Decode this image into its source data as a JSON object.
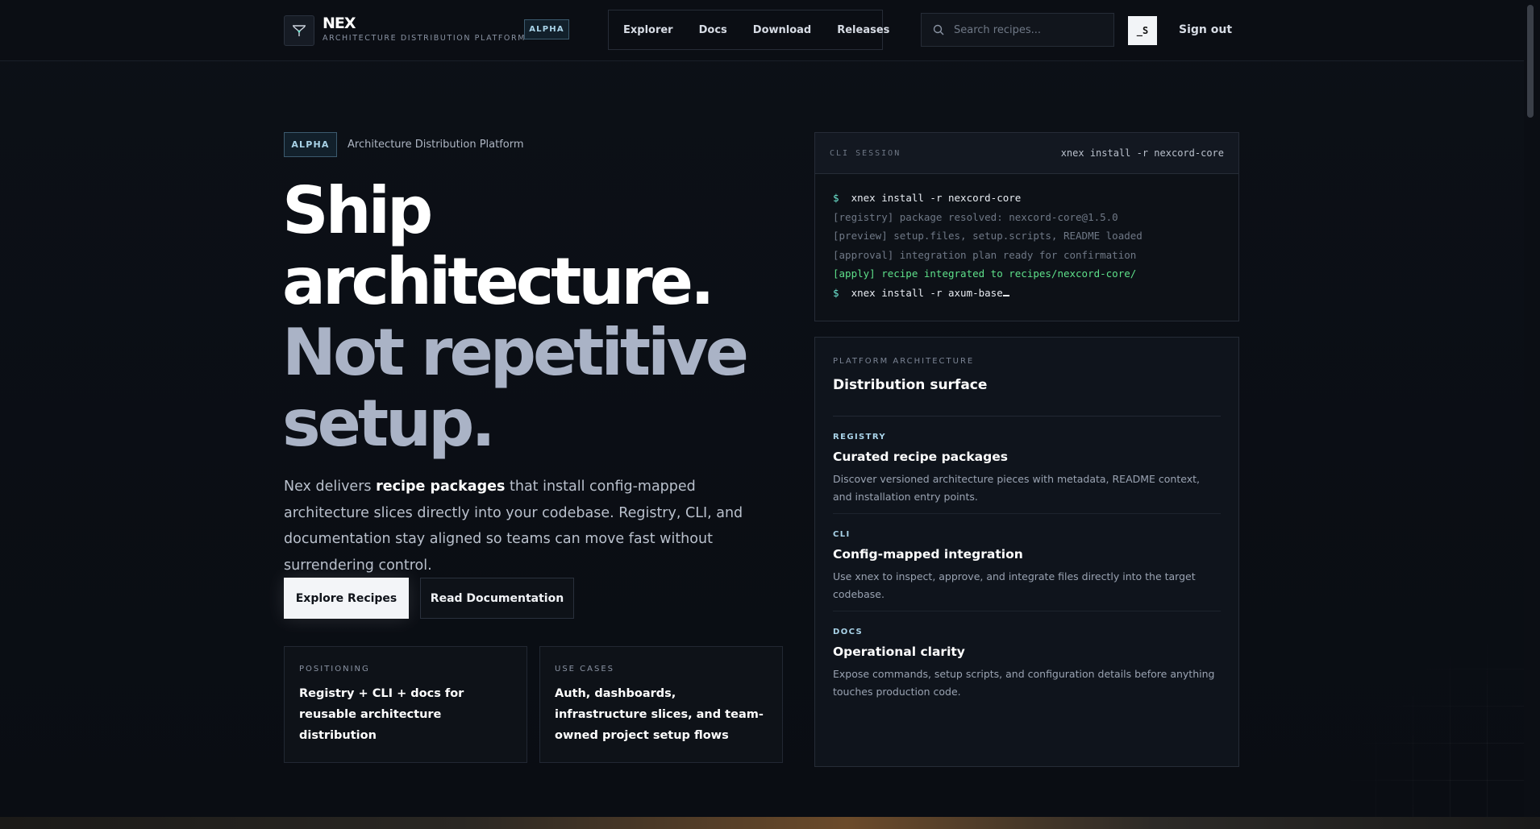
{
  "header": {
    "brand": "NEX",
    "brand_subtitle": "ARCHITECTURE DISTRIBUTION PLATFORM",
    "badge": "ALPHA",
    "nav": [
      "Explorer",
      "Docs",
      "Download",
      "Releases"
    ],
    "search_placeholder": "Search recipes...",
    "avatar_initials": "_S",
    "sign_out": "Sign out"
  },
  "hero": {
    "badge": "ALPHA",
    "badge_text": "Architecture Distribution Platform",
    "title_lines": [
      "Ship",
      "architecture.",
      "Not repetitive",
      "setup."
    ],
    "desc_prefix": "Nex delivers ",
    "desc_strong": "recipe packages",
    "desc_suffix": " that install config-mapped architecture slices directly into your codebase. Registry, CLI, and documentation stay aligned so teams can move fast without surrendering control.",
    "primary_button": "Explore Recipes",
    "secondary_button": "Read Documentation",
    "cards": [
      {
        "label": "POSITIONING",
        "body": "Registry + CLI + docs for reusable architecture distribution"
      },
      {
        "label": "USE CASES",
        "body": "Auth, dashboards, infrastructure slices, and team-owned project setup flows"
      }
    ]
  },
  "terminal": {
    "label": "CLI SESSION",
    "header_cmd": "xnex install -r nexcord-core",
    "prompt": "$",
    "line1_cmd": "xnex install -r nexcord-core",
    "line2": "[registry] package resolved: nexcord-core@1.5.0",
    "line3": "[preview] setup.files, setup.scripts, README loaded",
    "line4": "[approval] integration plan ready for confirmation",
    "line5": "[apply] recipe integrated to recipes/nexcord-core/",
    "line6_cmd": "xnex install -r axum-base"
  },
  "architecture": {
    "label": "PLATFORM ARCHITECTURE",
    "title": "Distribution surface",
    "items": [
      {
        "tag": "REGISTRY",
        "title": "Curated recipe packages",
        "desc": "Discover versioned architecture pieces with metadata, README context, and installation entry points."
      },
      {
        "tag": "CLI",
        "title": "Config-mapped integration",
        "desc": "Use xnex to inspect, approve, and integrate files directly into the target codebase."
      },
      {
        "tag": "DOCS",
        "title": "Operational clarity",
        "desc": "Expose commands, setup scripts, and configuration details before anything touches production code."
      }
    ]
  }
}
